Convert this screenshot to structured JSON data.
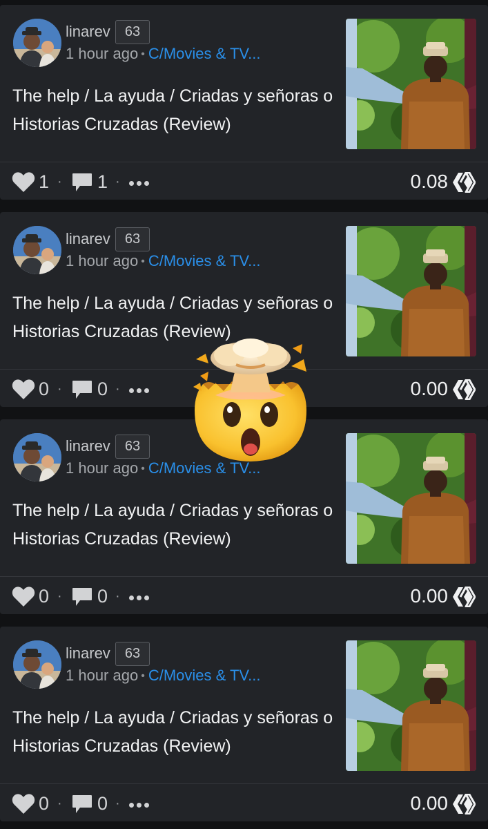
{
  "posts": [
    {
      "author": "linarev",
      "reputation": "63",
      "time": "1 hour ago",
      "community": "C/Movies & TV...",
      "title": "The help / La ayuda / Criadas y señoras o Historias Cruzadas (Review)",
      "likes": "1",
      "comments": "1",
      "payout": "0.08"
    },
    {
      "author": "linarev",
      "reputation": "63",
      "time": "1 hour ago",
      "community": "C/Movies & TV...",
      "title": "The help / La ayuda / Criadas y señoras o Historias Cruzadas (Review)",
      "likes": "0",
      "comments": "0",
      "payout": "0.00"
    },
    {
      "author": "linarev",
      "reputation": "63",
      "time": "1 hour ago",
      "community": "C/Movies & TV...",
      "title": "The help / La ayuda / Criadas y señoras o Historias Cruzadas (Review)",
      "likes": "0",
      "comments": "0",
      "payout": "0.00"
    },
    {
      "author": "linarev",
      "reputation": "63",
      "time": "1 hour ago",
      "community": "C/Movies & TV...",
      "title": "The help / La ayuda / Criadas y señoras o Historias Cruzadas (Review)",
      "likes": "0",
      "comments": "0",
      "payout": "0.00"
    }
  ],
  "meta_separator": "•",
  "action_separator": "·",
  "icons": {
    "like": "heart-icon",
    "comment": "comment-bubble-icon",
    "more": "more-dots-icon",
    "currency": "hive-logo-icon",
    "overlay": "exploding-head-emoji"
  },
  "colors": {
    "background": "#111214",
    "card": "#222428",
    "community_link": "#2a8fe9",
    "text_primary": "#f1f2f3",
    "text_secondary": "#a5a8ac"
  }
}
